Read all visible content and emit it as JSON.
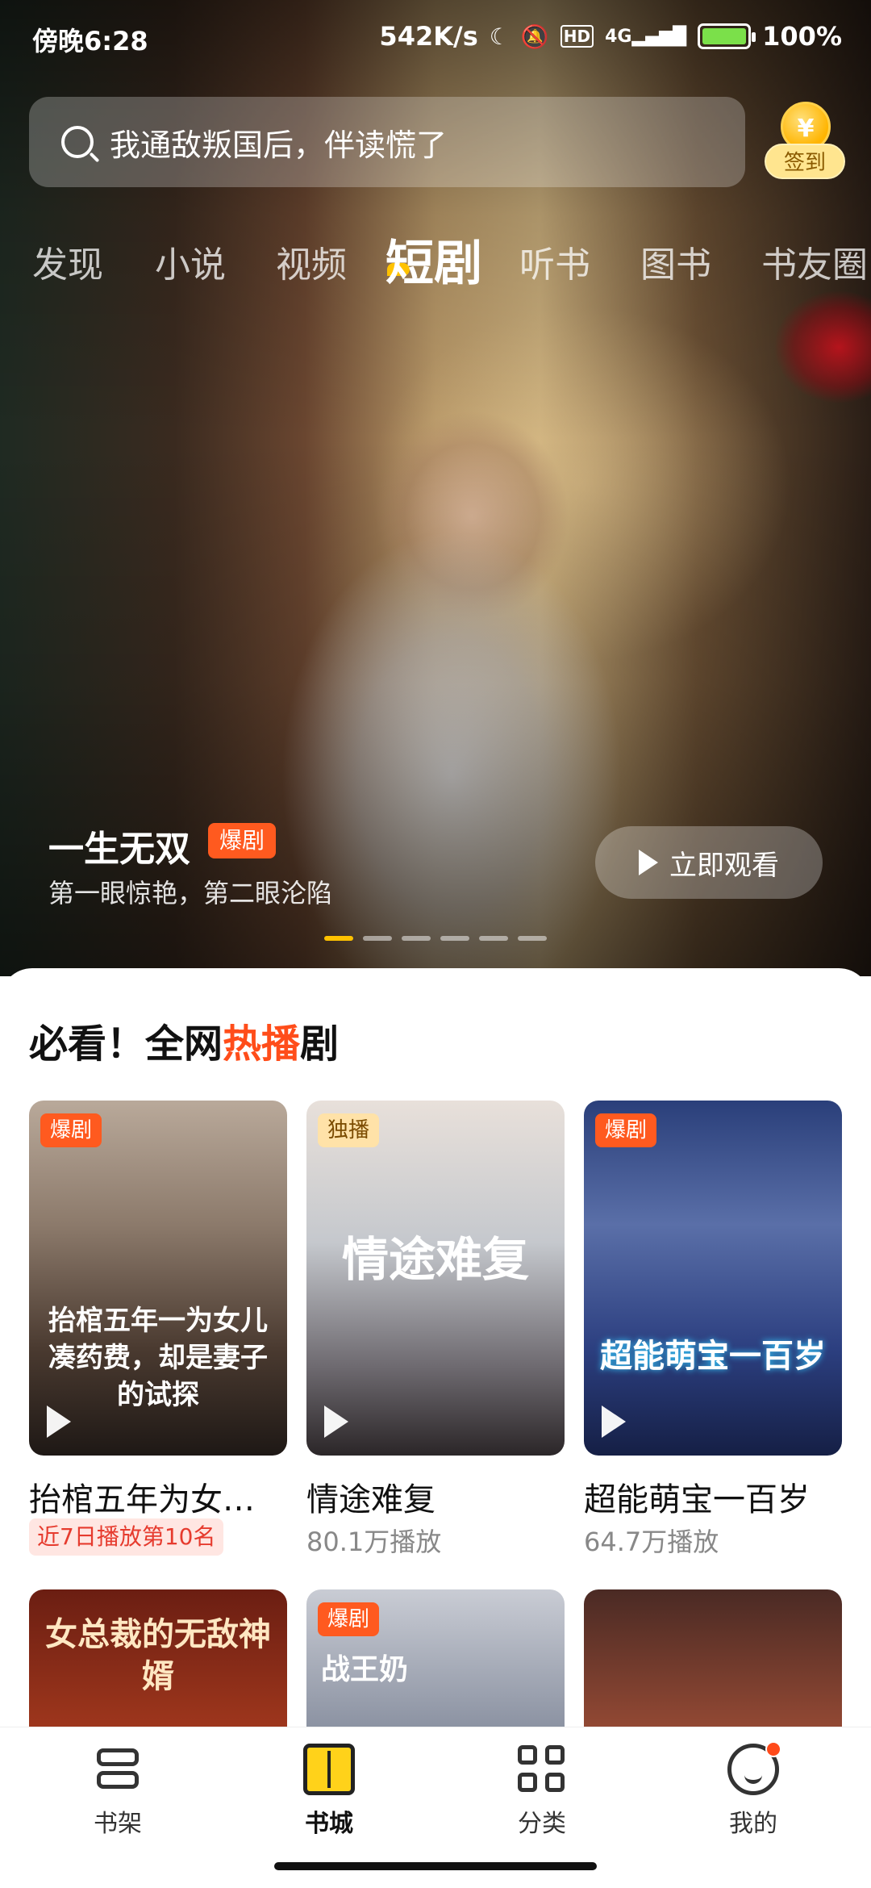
{
  "status": {
    "time": "傍晚6:28",
    "speed": "542K/s",
    "network": "4G",
    "hd": "HD",
    "battery": "100%"
  },
  "search": {
    "placeholder": "我通敌叛国后，伴读慌了"
  },
  "signin": {
    "coin": "¥",
    "label": "签到"
  },
  "tabs": [
    "发现",
    "小说",
    "视频",
    "短剧",
    "听书",
    "图书",
    "书友圈"
  ],
  "active_tab": "短剧",
  "hero": {
    "title": "一生无双",
    "badge": "爆剧",
    "subtitle": "第一眼惊艳，第二眼沦陷",
    "watch_label": "立即观看",
    "pages": 6,
    "current_page": 1
  },
  "section": {
    "title_pre": "必看！全网",
    "title_hot": "热播",
    "title_post": "剧"
  },
  "cards": [
    {
      "tag": "爆剧",
      "art": "抬棺五年一为女儿凑药费，却是妻子的试探",
      "title": "抬棺五年为女…",
      "rank": "近7日播放第10名"
    },
    {
      "tag": "独播",
      "art": "情途难复",
      "title": "情途难复",
      "plays": "80.1万播放"
    },
    {
      "tag": "爆剧",
      "art": "超能萌宝一百岁",
      "title": "超能萌宝一百岁",
      "plays": "64.7万播放"
    },
    {
      "art": "女总裁的无敌神婿"
    },
    {
      "tag": "爆剧",
      "art": "战王奶"
    },
    {
      "art": ""
    }
  ],
  "nav": [
    {
      "label": "书架",
      "icon": "bookshelf-icon"
    },
    {
      "label": "书城",
      "icon": "bookstore-icon"
    },
    {
      "label": "分类",
      "icon": "category-icon"
    },
    {
      "label": "我的",
      "icon": "profile-icon"
    }
  ],
  "nav_active": "书城",
  "colors": {
    "accent": "#ff5a1f",
    "highlight": "#ffc200",
    "hot_text": "#ff4d1a"
  }
}
